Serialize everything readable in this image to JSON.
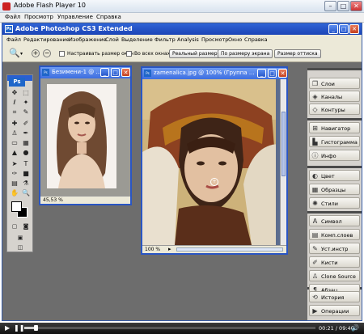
{
  "flash_player": {
    "title": "Adobe Flash Player 10",
    "menu": [
      "Файл",
      "Просмотр",
      "Управление",
      "Справка"
    ],
    "time": "00:21 / 09:40",
    "progress": 0.04
  },
  "photoshop": {
    "title": "Adobe Photoshop CS3 Extended",
    "menu": [
      "Файл",
      "Редактирование",
      "Изображение",
      "Слой",
      "Выделение",
      "Фильтр",
      "Analysis",
      "Просмотр",
      "Окно",
      "Справка"
    ],
    "options": {
      "zoom_value": "Q",
      "resize_windows": "Настраивать размер окон",
      "all_windows": "Во всех окнах",
      "actual_pixels": "Реальный размер",
      "fit_screen": "По размеру экрана",
      "print_size": "Размер оттиска"
    },
    "tools_logo": "Ps",
    "doc1": {
      "title": "Безимени-1 @ ...",
      "zoom": "45,53 %"
    },
    "doc2": {
      "title": "zamenalica.jpg @ 100% (Группа ...",
      "zoom": "100 %"
    },
    "panels": [
      {
        "icon": "layers-icon",
        "label": "Слои"
      },
      {
        "icon": "channels-icon",
        "label": "Каналы"
      },
      {
        "icon": "paths-icon",
        "label": "Контуры"
      },
      {
        "icon": "navigator-icon",
        "label": "Навигатор"
      },
      {
        "icon": "histogram-icon",
        "label": "Гистограмма"
      },
      {
        "icon": "info-icon",
        "label": "Инфо"
      },
      {
        "icon": "color-icon",
        "label": "Цвет"
      },
      {
        "icon": "swatches-icon",
        "label": "Образцы"
      },
      {
        "icon": "styles-icon",
        "label": "Стили"
      },
      {
        "icon": "character-icon",
        "label": "Символ"
      },
      {
        "icon": "layer-comps-icon",
        "label": "Комп.слоев"
      },
      {
        "icon": "tool-presets-icon",
        "label": "Уст.инстр"
      },
      {
        "icon": "brushes-icon",
        "label": "Кисти"
      },
      {
        "icon": "clone-source-icon",
        "label": "Clone Source"
      },
      {
        "icon": "paragraph-icon",
        "label": "Абзац"
      },
      {
        "icon": "history-icon",
        "label": "История"
      },
      {
        "icon": "actions-icon",
        "label": "Операции"
      }
    ]
  }
}
